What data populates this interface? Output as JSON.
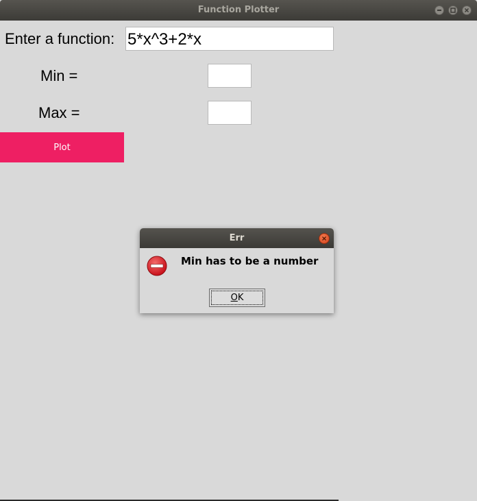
{
  "window": {
    "title": "Function Plotter",
    "controls": [
      "minimize-icon",
      "maximize-icon",
      "close-icon"
    ]
  },
  "form": {
    "function_label": "Enter a function:",
    "function_value": "5*x^3+2*x",
    "min_label": "Min =",
    "min_value": "",
    "max_label": "Max =",
    "max_value": "",
    "plot_label": "Plot"
  },
  "dialog": {
    "title": "Err",
    "message": "Min has to be a number",
    "icon": "error-icon",
    "ok_mnemonic": "O",
    "ok_rest": "K"
  },
  "colors": {
    "background": "#d9d9d9",
    "plot_button": "#ee1f63",
    "titlebar": "#3c3b37",
    "dialog_close": "#e0541f",
    "error_icon": "#d9141b"
  }
}
